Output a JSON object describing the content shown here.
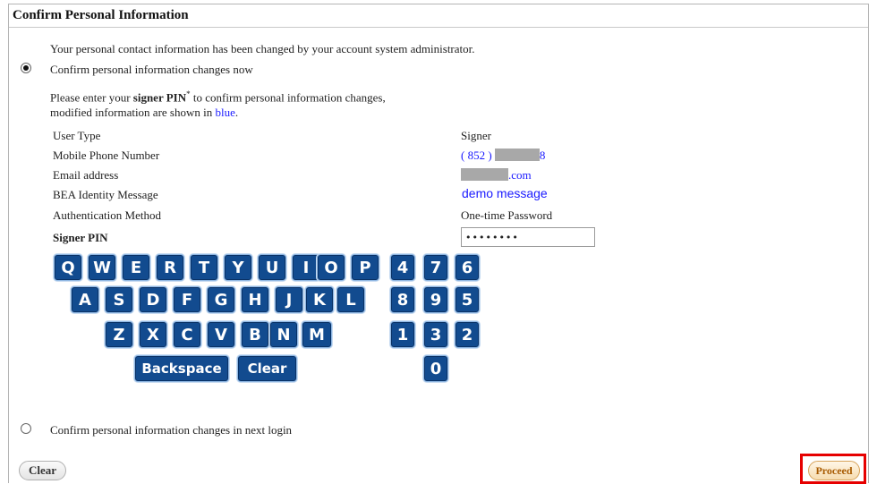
{
  "panel": {
    "title": "Confirm Personal Information",
    "notice": "Your personal contact information has been changed by your account system administrator."
  },
  "option_now": {
    "label": "Confirm personal information changes now",
    "selected": true,
    "instruction_pre": "Please enter your ",
    "instruction_bold": "signer PIN",
    "instruction_sup": "*",
    "instruction_post": " to confirm personal information changes,",
    "instruction_line2_pre": "modified information are shown in ",
    "instruction_line2_blue": "blue",
    "instruction_line2_post": "."
  },
  "info_rows": [
    {
      "label": "User Type",
      "value": "Signer"
    },
    {
      "label": "Mobile Phone Number",
      "value_prefix": "( 852 )",
      "value_suffix": "8"
    },
    {
      "label": "Email address",
      "value_suffix": ".com"
    },
    {
      "label": "BEA Identity Message",
      "value": "demo message"
    },
    {
      "label": "Authentication Method",
      "value": "One-time Password"
    }
  ],
  "signer_pin": {
    "label": "Signer PIN",
    "value": "••••••••"
  },
  "keypad": {
    "row1": [
      "Q",
      "W",
      "E",
      "R",
      "T",
      "Y",
      "U",
      "I",
      "O",
      "P"
    ],
    "row2": [
      "A",
      "S",
      "D",
      "F",
      "G",
      "H",
      "J",
      "K",
      "L"
    ],
    "row3": [
      "Z",
      "X",
      "C",
      "V",
      "B",
      "N",
      "M"
    ],
    "digits_row1": [
      "4",
      "7",
      "6"
    ],
    "digits_row2": [
      "8",
      "9",
      "5"
    ],
    "digits_row3": [
      "1",
      "3",
      "2"
    ],
    "digits_row4": [
      "0"
    ],
    "backspace_label": "Backspace",
    "clear_label": "Clear"
  },
  "option_next": {
    "label": "Confirm personal information changes in next login",
    "selected": false
  },
  "buttons": {
    "clear": "Clear",
    "proceed": "Proceed"
  },
  "colors": {
    "highlight_blue": "#1a1aff",
    "key_blue": "#124b8f",
    "focus_red": "#e60000"
  }
}
